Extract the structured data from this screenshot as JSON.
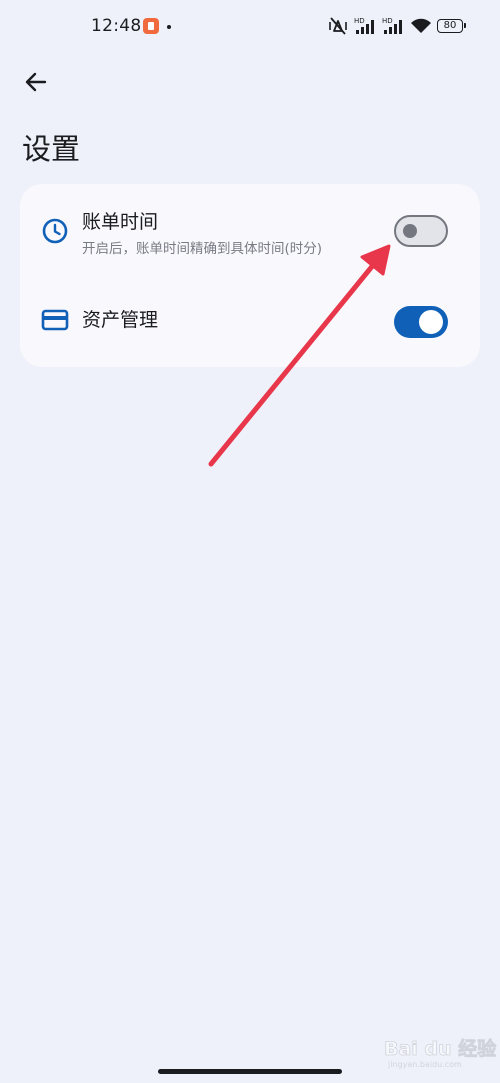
{
  "status_bar": {
    "time": "12:48",
    "battery": "80",
    "network_label_1": "HD",
    "network_label_2": "HD",
    "icons": [
      "app-notification-icon",
      "notification-dot",
      "vibrate-icon",
      "signal-icon",
      "signal-icon",
      "wifi-icon",
      "battery-icon"
    ]
  },
  "header": {
    "back_icon": "arrow-left-icon",
    "title": "设置"
  },
  "settings": {
    "items": [
      {
        "icon": "clock-icon",
        "title": "账单时间",
        "subtitle": "开启后，账单时间精确到具体时间(时分)",
        "enabled": false
      },
      {
        "icon": "card-icon",
        "title": "资产管理",
        "enabled": true
      }
    ]
  },
  "colors": {
    "background": "#eef1f9",
    "card": "#f8f8fd",
    "accent": "#1060b8",
    "annotation": "#e8364a"
  },
  "watermark": {
    "brand": "Bai du 经验",
    "url": "jingyan.baidu.com"
  }
}
